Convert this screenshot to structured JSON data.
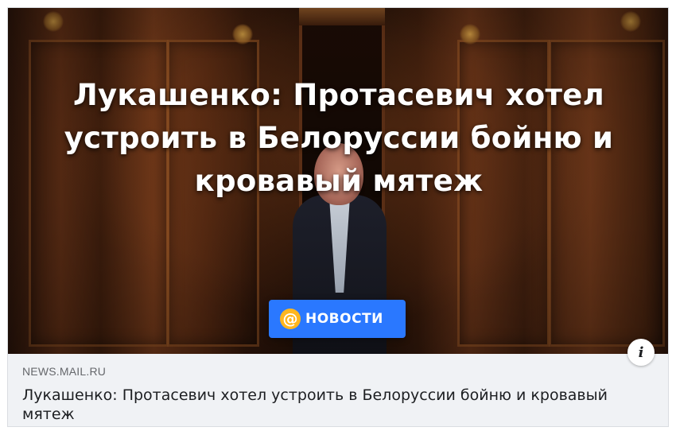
{
  "preview": {
    "headline": "Лукашенко: Протасевич хотел устроить в Белоруссии бойню и кровавый мятеж",
    "badge": {
      "icon_glyph": "@",
      "icon_name": "at-sign-icon",
      "label": "НОВОСТИ",
      "color": "#2a78ff"
    }
  },
  "info_button": {
    "glyph": "i",
    "icon_name": "info-icon"
  },
  "link": {
    "source": "NEWS.MAIL.RU",
    "title": "Лукашенко: Протасевич хотел устроить в Белоруссии бойню и кровавый мятеж"
  }
}
